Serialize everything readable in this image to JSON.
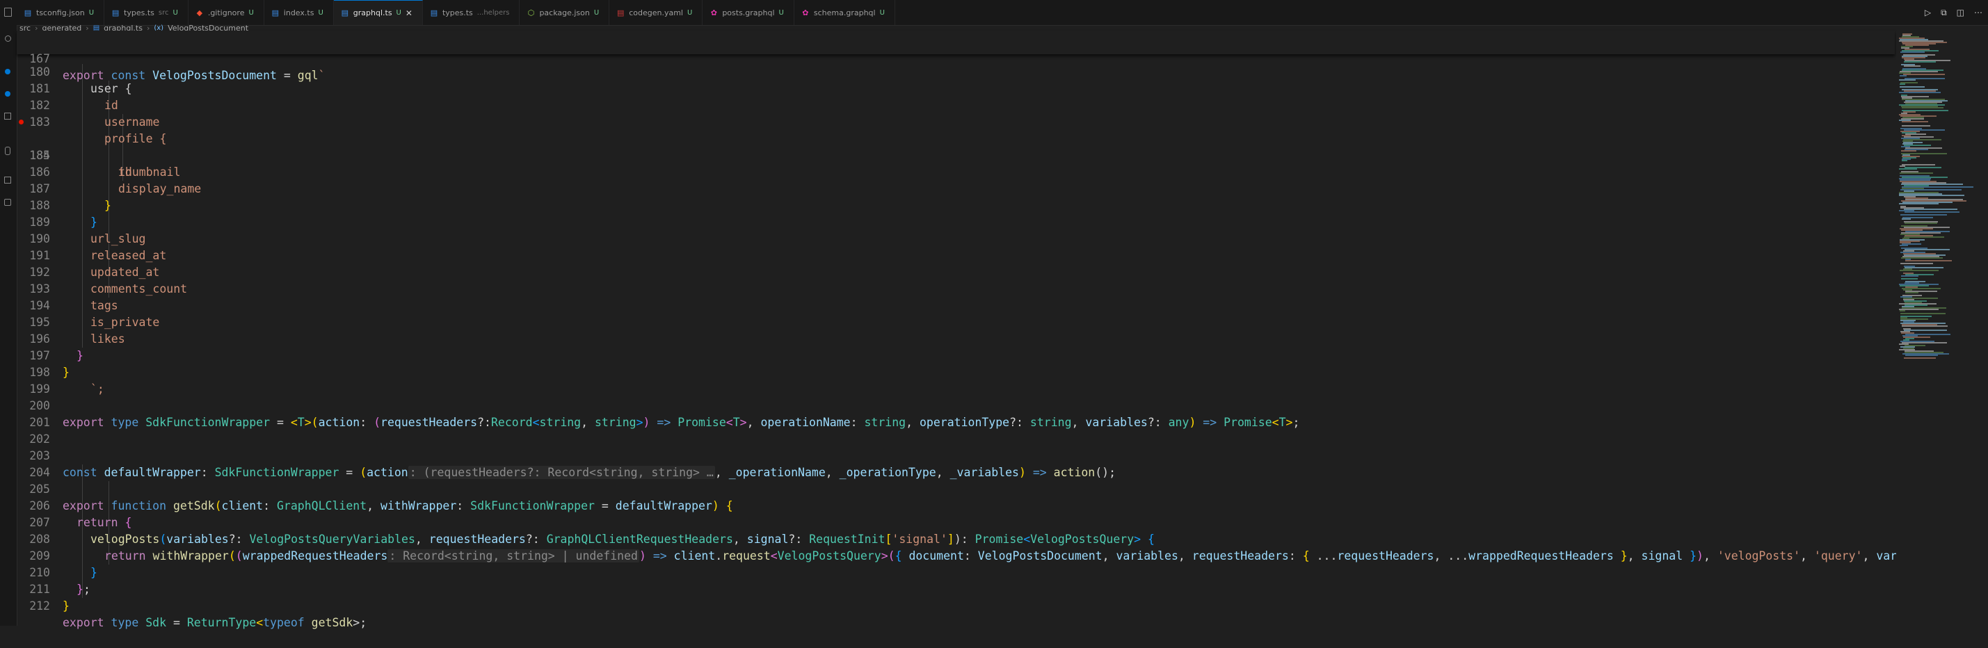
{
  "tabs": [
    {
      "label": "tsconfig.json",
      "icon": "json-icon",
      "status": "U",
      "active": false
    },
    {
      "label": "types.ts",
      "icon": "typescript-icon",
      "detail": "src",
      "status": "U",
      "active": false
    },
    {
      "label": ".gitignore",
      "icon": "git-icon",
      "status": "U",
      "active": false
    },
    {
      "label": "index.ts",
      "icon": "typescript-icon",
      "status": "U",
      "active": false
    },
    {
      "label": "graphql.ts",
      "icon": "typescript-icon",
      "status": "U",
      "active": true
    },
    {
      "label": "types.ts",
      "icon": "typescript-icon",
      "detail": "...helpers",
      "status": "",
      "active": false
    },
    {
      "label": "package.json",
      "icon": "npm-icon",
      "status": "U",
      "active": false
    },
    {
      "label": "codegen.yaml",
      "icon": "yaml-icon",
      "status": "U",
      "active": false
    },
    {
      "label": "posts.graphql",
      "icon": "graphql-icon",
      "status": "U",
      "active": false
    },
    {
      "label": "schema.graphql",
      "icon": "graphql-icon",
      "status": "U",
      "active": false
    }
  ],
  "breadcrumb": {
    "segments": [
      "src",
      "generated",
      "graphql.ts",
      "VelogPostsDocument"
    ]
  },
  "editor": {
    "sticky_line": {
      "num": "167"
    },
    "lines": [
      {
        "num": "180"
      },
      {
        "num": "181"
      },
      {
        "num": "182"
      },
      {
        "num": "183"
      },
      {
        "num": "184"
      },
      {
        "num": "185"
      },
      {
        "num": "186"
      },
      {
        "num": "187"
      },
      {
        "num": "188"
      },
      {
        "num": "189"
      },
      {
        "num": "190"
      },
      {
        "num": "191"
      },
      {
        "num": "192"
      },
      {
        "num": "193"
      },
      {
        "num": "194"
      },
      {
        "num": "195"
      },
      {
        "num": "196"
      },
      {
        "num": "197"
      },
      {
        "num": "198"
      },
      {
        "num": "199"
      },
      {
        "num": "200"
      },
      {
        "num": "201"
      },
      {
        "num": "202"
      },
      {
        "num": "203"
      },
      {
        "num": "204"
      },
      {
        "num": "205"
      },
      {
        "num": "206"
      },
      {
        "num": "207"
      },
      {
        "num": "208"
      },
      {
        "num": "209"
      },
      {
        "num": "210"
      },
      {
        "num": "211"
      },
      {
        "num": "212"
      }
    ],
    "code": {
      "l167": {
        "export": "export",
        "const": "const",
        "name": "VelogPostsDocument",
        "eq": " = ",
        "gql": "gql",
        "tick": "`"
      },
      "l180": "user {",
      "l181": "id",
      "l182": "username",
      "l183": "profile {",
      "l184": "id",
      "l185": "thumbnail",
      "l186": "display_name",
      "l187": "}",
      "l188": "}",
      "l189": "url_slug",
      "l190": "released_at",
      "l191": "updated_at",
      "l192": "comments_count",
      "l193": "tags",
      "l194": "is_private",
      "l195": "likes",
      "l196": "}",
      "l197": "}",
      "l198": "`;",
      "l200": {
        "t1": "export",
        "t2": " type ",
        "t3": "SdkFunctionWrapper",
        "t4": " = ",
        "t5": "<",
        "t6": "T",
        "t7": ">",
        "t8": "(",
        "t9": "action",
        "t10": ": ",
        "t11": "(",
        "t12": "requestHeaders",
        "t13": "?:",
        "t14": "Record",
        "t15": "<",
        "t16": "string",
        "t17": ", ",
        "t18": "string",
        "t19": ">",
        "t20": ")",
        "t21": " => ",
        "t22": "Promise",
        "t23": "<",
        "t24": "T",
        "t25": ">",
        "t26": ", ",
        "t27": "operationName",
        "t28": ": ",
        "t29": "string",
        "t30": ", ",
        "t31": "operationType",
        "t32": "?: ",
        "t33": "string",
        "t34": ", ",
        "t35": "variables",
        "t36": "?: ",
        "t37": "any",
        "t38": ")",
        "t39": " => ",
        "t40": "Promise",
        "t41": "<",
        "t42": "T",
        "t43": ">",
        "t44": ";"
      },
      "l203": {
        "t1": "const",
        "t2": " ",
        "t3": "defaultWrapper",
        "t4": ": ",
        "t5": "SdkFunctionWrapper",
        "t6": " = ",
        "t7": "(",
        "t8": "action",
        "t9": ": (requestHeaders?: Record<string, string> …",
        "t10": ", ",
        "t11": "_operationName",
        "t12": ", ",
        "t13": "_operationType",
        "t14": ", ",
        "t15": "_variables",
        "t16": ")",
        "t17": " => ",
        "t18": "action",
        "t19": "();"
      },
      "l205": {
        "t1": "export",
        "t2": " ",
        "t3": "function",
        "t4": " ",
        "t5": "getSdk",
        "t6": "(",
        "t7": "client",
        "t8": ": ",
        "t9": "GraphQLClient",
        "t10": ", ",
        "t11": "withWrapper",
        "t12": ": ",
        "t13": "SdkFunctionWrapper",
        "t14": " = ",
        "t15": "defaultWrapper",
        "t16": ")",
        "t17": " {"
      },
      "l206": {
        "t1": "return",
        "t2": " {"
      },
      "l207": {
        "t1": "velogPosts",
        "t2": "(",
        "t3": "variables",
        "t4": "?: ",
        "t5": "VelogPostsQueryVariables",
        "t6": ", ",
        "t7": "requestHeaders",
        "t8": "?: ",
        "t9": "GraphQLClientRequestHeaders",
        "t10": ", ",
        "t11": "signal",
        "t12": "?: ",
        "t13": "RequestInit",
        "t14": "[",
        "t15": "'signal'",
        "t16": "]",
        "t17": "): ",
        "t18": "Promise",
        "t19": "<",
        "t20": "VelogPostsQuery",
        "t21": ">",
        "t22": " {"
      },
      "l208": {
        "t1": "return",
        "t2": " ",
        "t3": "withWrapper",
        "t4": "(",
        "t5": "(",
        "t6": "wrappedRequestHeaders",
        "t7": ": Record<string, string> | undefined",
        "t8": ")",
        "t9": " => ",
        "t10": "client",
        "t11": ".",
        "t12": "request",
        "t13": "<",
        "t14": "VelogPostsQuery",
        "t15": ">",
        "t16": "(",
        "t17": "{",
        "t18": " ",
        "t19": "document",
        "t20": ": ",
        "t21": "VelogPostsDocument",
        "t22": ", ",
        "t23": "variables",
        "t24": ", ",
        "t25": "requestHeaders",
        "t26": ": ",
        "t27": "{",
        "t28": " ...",
        "t29": "requestHeaders",
        "t30": ", ...",
        "t31": "wrappedRequestHeaders",
        "t32": " ",
        "t33": "}",
        "t34": ", ",
        "t35": "signal",
        "t36": " ",
        "t37": "}",
        "t38": ")",
        "t39": ", ",
        "t40": "'velogPosts'",
        "t41": ", ",
        "t42": "'query'",
        "t43": ", ",
        "t44": "variables",
        "t45": ")"
      },
      "l209": "}",
      "l210": {
        "t1": "}",
        "t2": ";"
      },
      "l211": "}",
      "l212": {
        "t1": "export",
        "t2": " type ",
        "t3": "Sdk",
        "t4": " = ",
        "t5": "ReturnType",
        "t6": "<",
        "t7": "typeof",
        "t8": " ",
        "t9": "getSdk",
        "t10": ">;"
      }
    }
  },
  "colors": {
    "accent": "#0078d4",
    "modified": "#73c991",
    "breakpoint": "#e51400"
  }
}
